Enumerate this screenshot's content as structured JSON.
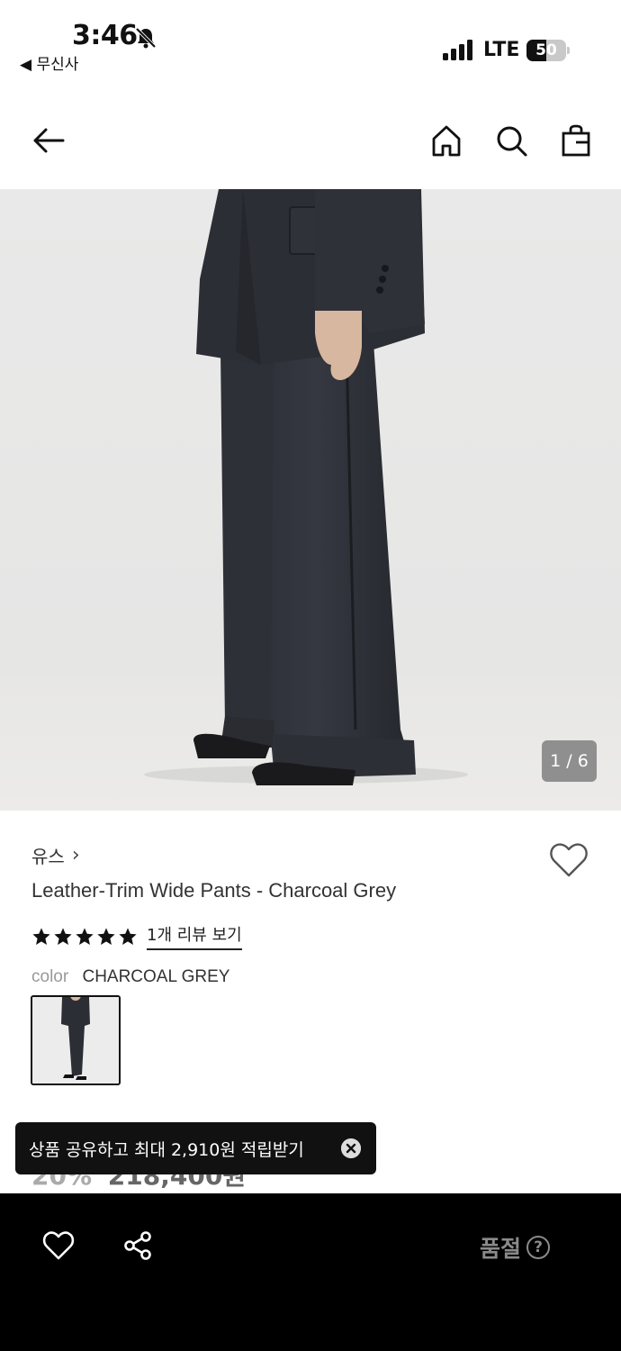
{
  "status_bar": {
    "time": "3:46",
    "back_app": "◀ 무신사",
    "network": "LTE",
    "battery": "50",
    "battery_level": 0.5
  },
  "nav": {
    "icons": [
      "back-arrow-icon",
      "home-icon",
      "search-icon",
      "shopping-bag-icon"
    ]
  },
  "gallery": {
    "counter": "1 / 6"
  },
  "product": {
    "brand": "유스",
    "brand_chevron": "›",
    "name": "Leather-Trim Wide Pants - Charcoal Grey",
    "rating": 5,
    "review_link": "1개 리뷰 보기",
    "color_label": "color",
    "color_value": "CHARCOAL GREY"
  },
  "price": {
    "discount": "20%",
    "amount": "218,400원"
  },
  "toast": {
    "text": "상품 공유하고 최대 2,910원 적립받기"
  },
  "bottom_bar": {
    "soldout_label": "품절",
    "help_glyph": "?"
  },
  "colors": {
    "black": "#000000",
    "toast_bg": "#111111",
    "soldout_gray": "#8a8a8a",
    "counter_bg": "#8f8f8f"
  }
}
